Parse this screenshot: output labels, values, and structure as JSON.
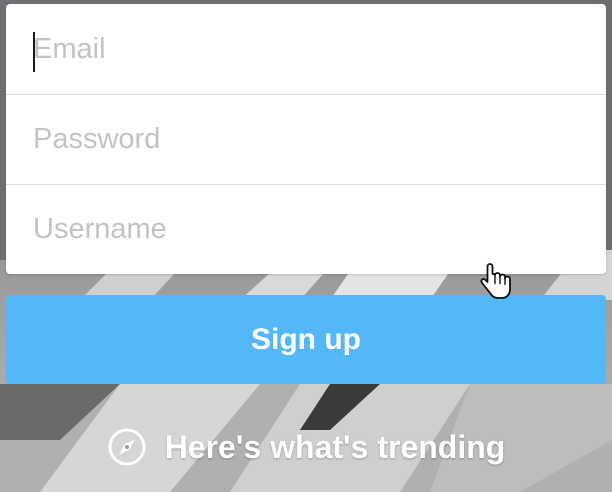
{
  "form": {
    "email": {
      "placeholder": "Email",
      "value": ""
    },
    "password": {
      "placeholder": "Password",
      "value": ""
    },
    "username": {
      "placeholder": "Username",
      "value": ""
    }
  },
  "signup_button": {
    "label": "Sign up"
  },
  "trending_link": {
    "label": "Here's what's trending",
    "icon": "compass-icon"
  },
  "colors": {
    "accent": "#52b8f8",
    "placeholder": "#c3c3c6",
    "field_divider": "#dcdcdc",
    "link_text": "#ffffff"
  }
}
